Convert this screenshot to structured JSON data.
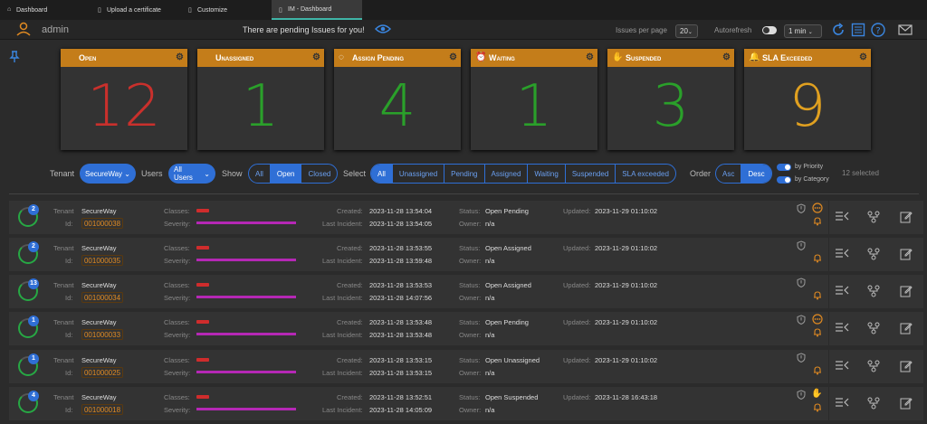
{
  "tabs": [
    {
      "icon": "home-icon",
      "label": "Dashboard"
    },
    {
      "icon": "file-icon",
      "label": "Upload a certificate"
    },
    {
      "icon": "file-icon",
      "label": "Customize"
    },
    {
      "icon": "file-icon",
      "label": "IM - Dashboard"
    }
  ],
  "header": {
    "username": "admin",
    "pending_msg": "There are pending Issues for you!",
    "issues_per_page_label": "Issues per page",
    "issues_per_page_value": "20",
    "autorefresh_label": "Autorefresh",
    "autorefresh_interval": "1 min"
  },
  "cards": [
    {
      "title": "Open",
      "value": "12",
      "color": "#c9302c",
      "icon": ""
    },
    {
      "title": "Unassigned",
      "value": "1",
      "color": "#2aa02a",
      "icon": ""
    },
    {
      "title": "Assign Pending",
      "value": "4",
      "color": "#2aa02a",
      "icon": "dots-circle-icon"
    },
    {
      "title": "Waiting",
      "value": "1",
      "color": "#2aa02a",
      "icon": "alarm-icon"
    },
    {
      "title": "Suspended",
      "value": "3",
      "color": "#2aa02a",
      "icon": "hand-icon"
    },
    {
      "title": "SLA Exceeded",
      "value": "9",
      "color": "#e0a020",
      "icon": "bell-icon"
    }
  ],
  "filters": {
    "tenant_label": "Tenant",
    "tenant_value": "SecureWay",
    "users_label": "Users",
    "users_value": "All Users",
    "show_label": "Show",
    "show_options": [
      "All",
      "Open",
      "Closed"
    ],
    "select_label": "Select",
    "select_options": [
      "All",
      "Unassigned",
      "Pending",
      "Assigned",
      "Waiting",
      "Suspended",
      "SLA exceeded"
    ],
    "order_label": "Order",
    "order_options": [
      "Asc",
      "Desc"
    ],
    "by_priority": "by Priority",
    "by_category": "by Category",
    "selected_count": "12 selected"
  },
  "labels": {
    "tenant": "Tenant",
    "id": "Id:",
    "classes": "Classes:",
    "severity": "Severity:",
    "created": "Created:",
    "last_incident": "Last Incident:",
    "status": "Status:",
    "owner": "Owner:",
    "updated": "Updated:"
  },
  "issues": [
    {
      "badge": "2",
      "tenant": "SecureWay",
      "id": "001000038",
      "created": "2023-11-28 13:54:04",
      "last": "2023-11-28 13:54:05",
      "status": "Open Pending",
      "owner": "n/a",
      "updated": "2023-11-29 01:10:02",
      "status_icon": "dots"
    },
    {
      "badge": "2",
      "tenant": "SecureWay",
      "id": "001000035",
      "created": "2023-11-28 13:53:55",
      "last": "2023-11-28 13:59:48",
      "status": "Open Assigned",
      "owner": "n/a",
      "updated": "2023-11-29 01:10:02",
      "status_icon": ""
    },
    {
      "badge": "13",
      "tenant": "SecureWay",
      "id": "001000034",
      "created": "2023-11-28 13:53:53",
      "last": "2023-11-28 14:07:56",
      "status": "Open Assigned",
      "owner": "n/a",
      "updated": "2023-11-29 01:10:02",
      "status_icon": ""
    },
    {
      "badge": "1",
      "tenant": "SecureWay",
      "id": "001000033",
      "created": "2023-11-28 13:53:48",
      "last": "2023-11-28 13:53:48",
      "status": "Open Pending",
      "owner": "n/a",
      "updated": "2023-11-29 01:10:02",
      "status_icon": "dots"
    },
    {
      "badge": "1",
      "tenant": "SecureWay",
      "id": "001000025",
      "created": "2023-11-28 13:53:15",
      "last": "2023-11-28 13:53:15",
      "status": "Open Unassigned",
      "owner": "n/a",
      "updated": "2023-11-29 01:10:02",
      "status_icon": ""
    },
    {
      "badge": "4",
      "tenant": "SecureWay",
      "id": "001000018",
      "created": "2023-11-28 13:52:51",
      "last": "2023-11-28 14:05:09",
      "status": "Open Suspended",
      "owner": "n/a",
      "updated": "2023-11-28 16:43:18",
      "status_icon": "hand"
    }
  ]
}
